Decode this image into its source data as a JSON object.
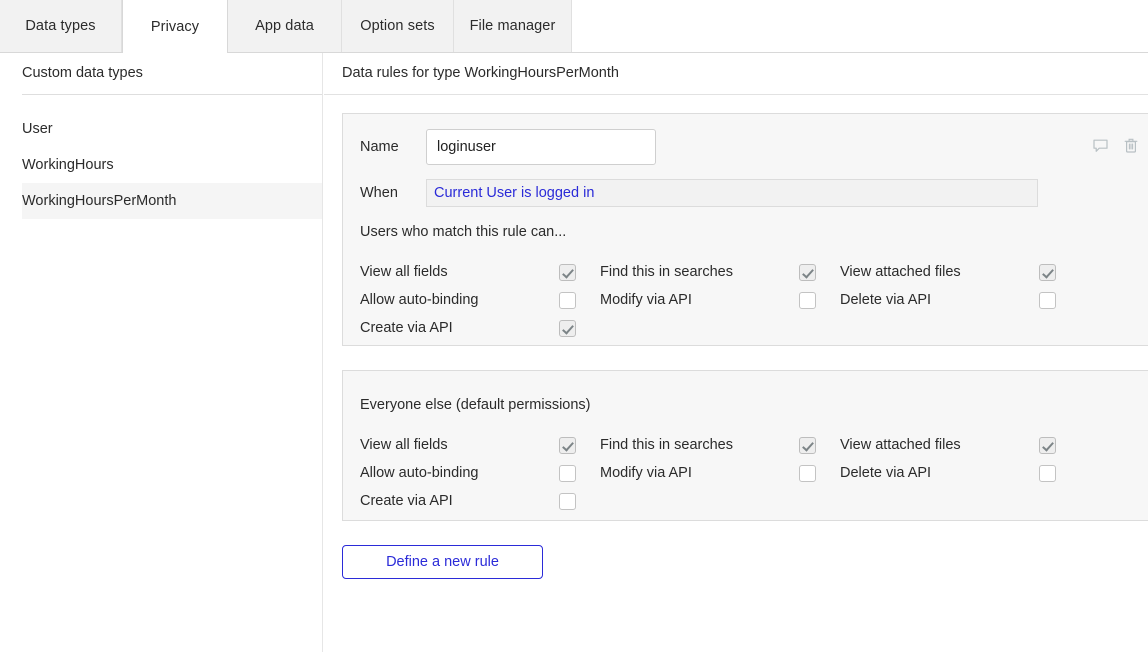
{
  "tabs": [
    {
      "label": "Data types",
      "active": false
    },
    {
      "label": "Privacy",
      "active": true
    },
    {
      "label": "App data",
      "active": false
    },
    {
      "label": "Option sets",
      "active": false
    },
    {
      "label": "File manager",
      "active": false
    }
  ],
  "sidebar": {
    "title": "Custom data types",
    "items": [
      {
        "label": "User",
        "selected": false
      },
      {
        "label": "WorkingHours",
        "selected": false
      },
      {
        "label": "WorkingHoursPerMonth",
        "selected": true
      }
    ]
  },
  "content": {
    "title": "Data rules for type WorkingHoursPerMonth",
    "new_rule_button": "Define a new rule"
  },
  "rule_card": {
    "name_label": "Name",
    "name_value": "loginuser",
    "name_placeholder": "",
    "when_label": "When",
    "when_value": "Current User is logged in",
    "section_label": "Users who match this rule can...",
    "comment_icon": "speech-bubble-icon",
    "delete_icon": "trash-icon",
    "permissions": [
      [
        {
          "label": "View all fields",
          "checked": true
        },
        {
          "label": "Find this in searches",
          "checked": true
        },
        {
          "label": "View attached files",
          "checked": true
        }
      ],
      [
        {
          "label": "Allow auto-binding",
          "checked": false
        },
        {
          "label": "Modify via API",
          "checked": false
        },
        {
          "label": "Delete via API",
          "checked": false
        }
      ],
      [
        {
          "label": "Create via API",
          "checked": true
        },
        {
          "label": "",
          "checked": false,
          "empty": true
        },
        {
          "label": "",
          "checked": false,
          "empty": true
        }
      ]
    ]
  },
  "default_card": {
    "section_label": "Everyone else (default permissions)",
    "permissions": [
      [
        {
          "label": "View all fields",
          "checked": true
        },
        {
          "label": "Find this in searches",
          "checked": true
        },
        {
          "label": "View attached files",
          "checked": true
        }
      ],
      [
        {
          "label": "Allow auto-binding",
          "checked": false
        },
        {
          "label": "Modify via API",
          "checked": false
        },
        {
          "label": "Delete via API",
          "checked": false
        }
      ],
      [
        {
          "label": "Create via API",
          "checked": false
        },
        {
          "label": "",
          "checked": false,
          "empty": true
        },
        {
          "label": "",
          "checked": false,
          "empty": true
        }
      ]
    ]
  },
  "colors": {
    "accent": "#2b2bd8",
    "card_bg": "#f7f7f7",
    "card_border": "#dcdcdc",
    "tab_inactive_bg": "#f2f2f2",
    "selected_item_bg": "#f5f5f5"
  }
}
